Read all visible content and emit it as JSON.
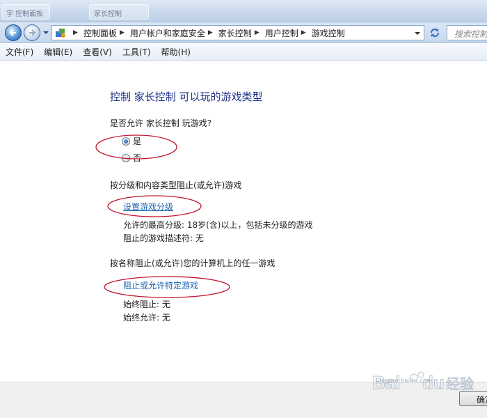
{
  "title_bar": {
    "ghost_label_1": "字 控制面板",
    "ghost_label_2": "家长控制"
  },
  "breadcrumb": [
    "控制面板",
    "用户帐户和家庭安全",
    "家长控制",
    "用户控制",
    "游戏控制"
  ],
  "search": {
    "placeholder": "搜索控制"
  },
  "menu": [
    "文件(F)",
    "编辑(E)",
    "查看(V)",
    "工具(T)",
    "帮助(H)"
  ],
  "page": {
    "title": "控制 家长控制 可以玩的游戏类型",
    "allow_question": "是否允许 家长控制 玩游戏?",
    "yes_label": "是",
    "no_label": "否",
    "rating_heading": "按分级和内容类型阻止(或允许)游戏",
    "rating_link": "设置游戏分级",
    "max_rating": "允许的最高分级:  18岁(含)以上，包括未分级的游戏",
    "blocked_descriptors": "阻止的游戏描述符: 无",
    "name_heading": "按名称阻止(或允许)您的计算机上的任一游戏",
    "specific_link": "阻止或允许特定游戏",
    "always_block": "始终阻止: 无",
    "always_allow": "始终允许: 无"
  },
  "footer": {
    "ok_label": "确定",
    "watermark_text": "jingyan.baidu.com"
  },
  "icons": {
    "back": "back-arrow-icon",
    "forward": "forward-arrow-icon",
    "refresh": "refresh-icon",
    "control_panel": "control-panel-icon",
    "dropdown": "chevron-down-icon"
  },
  "colors": {
    "title": "#1e3287",
    "link": "#1b63b0",
    "annotation": "#c0142d"
  }
}
